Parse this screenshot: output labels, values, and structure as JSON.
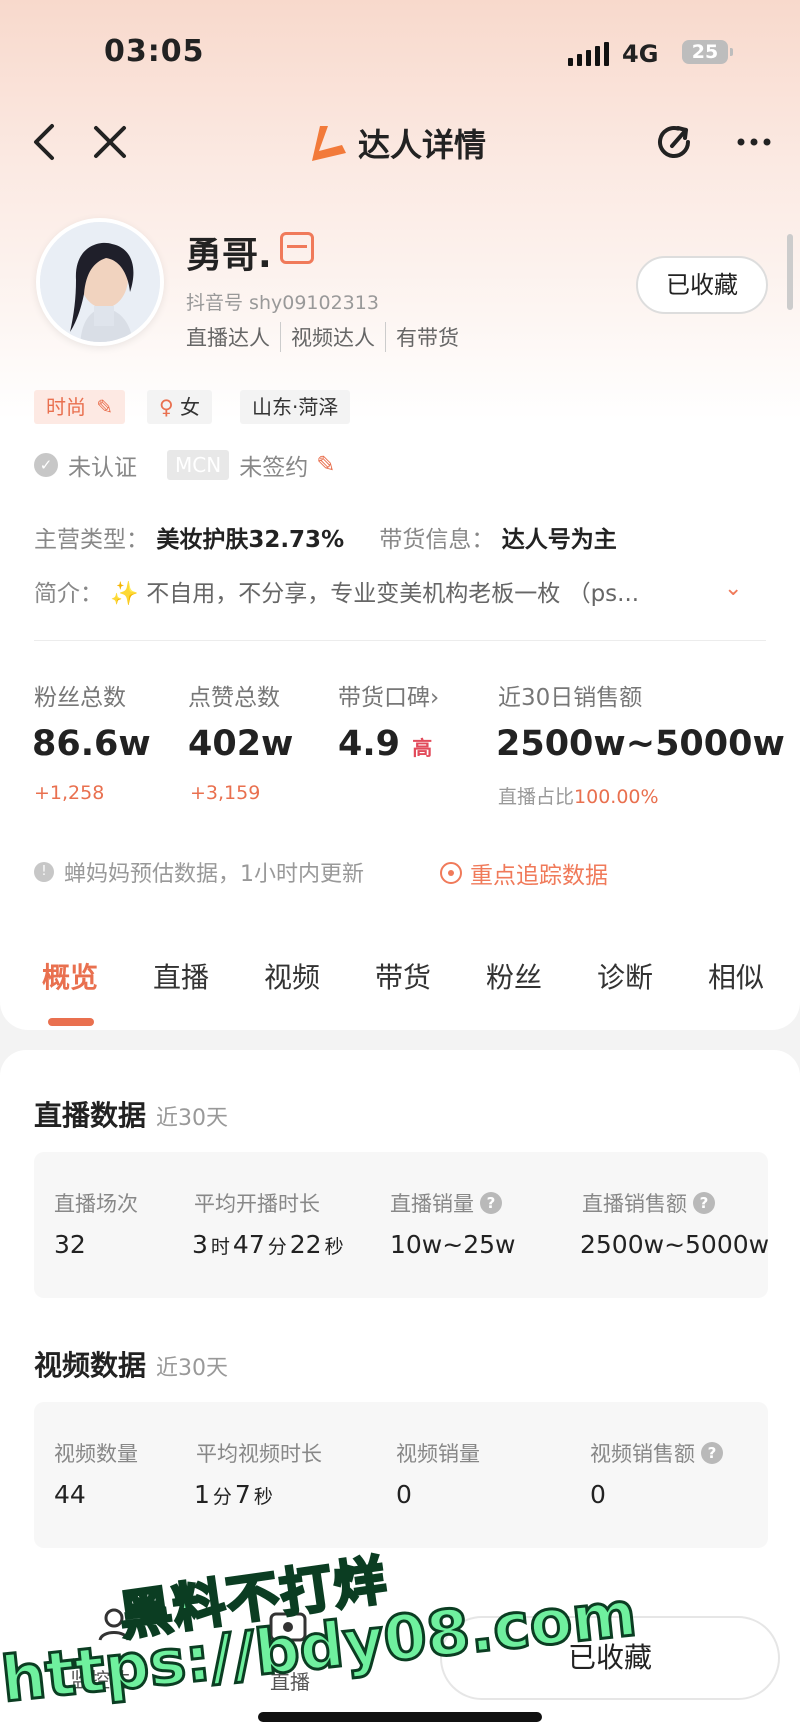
{
  "status_bar": {
    "time": "03:05",
    "network": "4G",
    "battery": "25"
  },
  "nav": {
    "title": "达人详情"
  },
  "profile": {
    "name": "勇哥.",
    "douyin_id": "抖音号 shy09102313",
    "roles": [
      "直播达人",
      "视频达人",
      "有带货"
    ],
    "favorite_label": "已收藏",
    "tags": {
      "category": "时尚",
      "gender": "女",
      "region": "山东·菏泽"
    },
    "cert_status": "未认证",
    "mcn_badge": "MCN",
    "mcn_status": "未签约",
    "main_type_label": "主营类型：",
    "main_type_value": "美妆护肤32.73%",
    "sales_info_label": "带货信息：",
    "sales_info_value": "达人号为主",
    "intro_label": "简介：",
    "intro_text": "✨ 不自用，不分享，专业变美机构老板一枚 （ps..."
  },
  "stats": {
    "fans": {
      "label": "粉丝总数",
      "value": "86.6w",
      "delta": "+1,258"
    },
    "likes": {
      "label": "点赞总数",
      "value": "402w",
      "delta": "+3,159"
    },
    "reputation": {
      "label": "带货口碑›",
      "value": "4.9",
      "level": "高"
    },
    "sales30": {
      "label": "近30日销售额",
      "value": "2500w~5000w",
      "share_label": "直播占比",
      "share_value": "100.00%"
    }
  },
  "notice": {
    "text": "蝉妈妈预估数据，1小时内更新",
    "track_label": "重点追踪数据"
  },
  "tabs": [
    "概览",
    "直播",
    "视频",
    "带货",
    "粉丝",
    "诊断",
    "相似"
  ],
  "live_section": {
    "title": "直播数据",
    "period": "近30天",
    "cells": [
      {
        "label": "直播场次",
        "value": "32"
      },
      {
        "label": "平均开播时长",
        "h": "3",
        "h_unit": "时",
        "m": "47",
        "m_unit": "分",
        "s": "22",
        "s_unit": "秒"
      },
      {
        "label": "直播销量",
        "value": "10w~25w"
      },
      {
        "label": "直播销售额",
        "value": "2500w~5000w"
      }
    ]
  },
  "video_section": {
    "title": "视频数据",
    "period": "近30天",
    "cells": [
      {
        "label": "视频数量",
        "value": "44"
      },
      {
        "label": "平均视频时长",
        "m": "1",
        "m_unit": "分",
        "s": "7",
        "s_unit": "秒"
      },
      {
        "label": "视频销量",
        "value": "0"
      },
      {
        "label": "视频销售额",
        "value": "0"
      }
    ]
  },
  "bottom_bar": {
    "monitor_label": "监控达",
    "live_label": "直播",
    "favorite_label": "已收藏"
  },
  "watermark": {
    "line1": "黑料不打烊",
    "line2": "https://bdy08.com"
  }
}
